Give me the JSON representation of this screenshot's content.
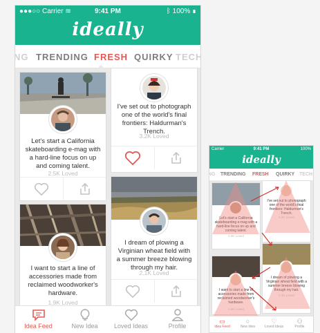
{
  "status": {
    "carrier": "Carrier",
    "time": "9:41 PM",
    "battery": "100%"
  },
  "app": {
    "logo": "ideally"
  },
  "tabs": [
    {
      "label": "NG"
    },
    {
      "label": "TRENDING"
    },
    {
      "label": "FRESH"
    },
    {
      "label": "QUIRKY"
    },
    {
      "label": "TECH"
    }
  ],
  "cards": [
    {
      "text": "Let's start a California skateboarding e-mag with a hard-line focus on up and coming talent.",
      "loved": "2.5K Loved"
    },
    {
      "text": "I've set out to photograph one of the world's final frontiers: Haldurman's Trench.",
      "loved": "3.2K Loved"
    },
    {
      "text": "I dream of plowing a Virginian wheat field with a summer breeze blowing through my hair.",
      "loved": "2.1K Loved"
    },
    {
      "text": "I want to start a line of accessories made from reclaimed woodworker's hardware.",
      "loved": "1.9K Loved"
    }
  ],
  "nav": [
    {
      "label": "Idea Feed"
    },
    {
      "label": "New Idea"
    },
    {
      "label": "Loved Ideas"
    },
    {
      "label": "Profile"
    }
  ],
  "colors": {
    "brand": "#1ab38f",
    "accent": "#e05a55"
  }
}
